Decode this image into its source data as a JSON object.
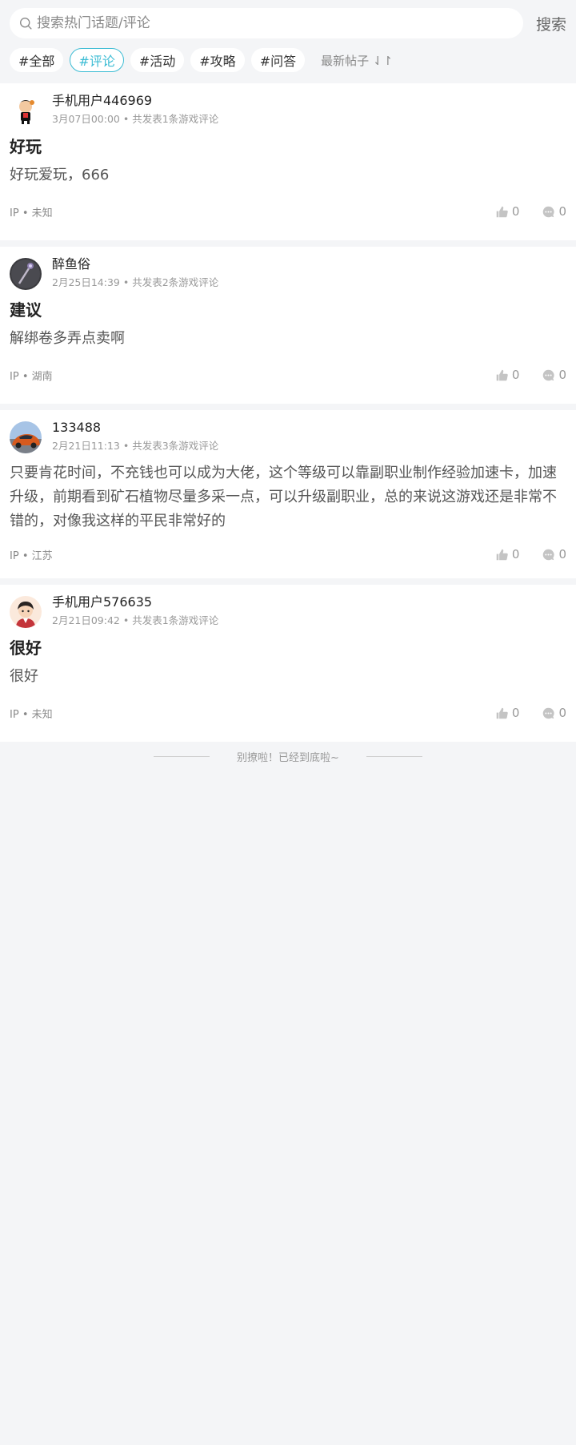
{
  "search": {
    "placeholder": "搜索热门话题/评论",
    "button_label": "搜索"
  },
  "tags": [
    {
      "label": "#全部",
      "active": false
    },
    {
      "label": "#评论",
      "active": true
    },
    {
      "label": "#活动",
      "active": false
    },
    {
      "label": "#攻略",
      "active": false
    },
    {
      "label": "#问答",
      "active": false
    }
  ],
  "sort": {
    "label": "最新帖子",
    "icon": "sort-arrows-icon"
  },
  "colors": {
    "accent": "#3cbcd4",
    "background": "#f4f5f7"
  },
  "posts": [
    {
      "username": "手机用户446969",
      "time": "3月07日00:00",
      "separator": "•",
      "stats": "共发表1条游戏评论",
      "title": "好玩",
      "body": "好玩爱玩，666",
      "ip_label": "IP",
      "ip_location": "未知",
      "likes": "0",
      "comments": "0",
      "avatar": "cartoon-kid-avatar"
    },
    {
      "username": "醉鱼俗",
      "time": "2月25日14:39",
      "separator": "•",
      "stats": "共发表2条游戏评论",
      "title": "建议",
      "body": "解绑卷多弄点卖啊",
      "ip_label": "IP",
      "ip_location": "湖南",
      "likes": "0",
      "comments": "0",
      "avatar": "dark-staff-avatar"
    },
    {
      "username": "133488",
      "time": "2月21日11:13",
      "separator": "•",
      "stats": "共发表3条游戏评论",
      "title": "",
      "body": "只要肯花时间，不充钱也可以成为大佬，这个等级可以靠副职业制作经验加速卡，加速升级，前期看到矿石植物尽量多采一点，可以升级副职业，总的来说这游戏还是非常不错的，对像我这样的平民非常好的",
      "ip_label": "IP",
      "ip_location": "江苏",
      "likes": "0",
      "comments": "0",
      "avatar": "car-avatar"
    },
    {
      "username": "手机用户576635",
      "time": "2月21日09:42",
      "separator": "•",
      "stats": "共发表1条游戏评论",
      "title": "很好",
      "body": "很好",
      "ip_label": "IP",
      "ip_location": "未知",
      "likes": "0",
      "comments": "0",
      "avatar": "cartoon-boy-avatar"
    }
  ],
  "footer": {
    "end_text": "别撩啦！已经到底啦~"
  }
}
